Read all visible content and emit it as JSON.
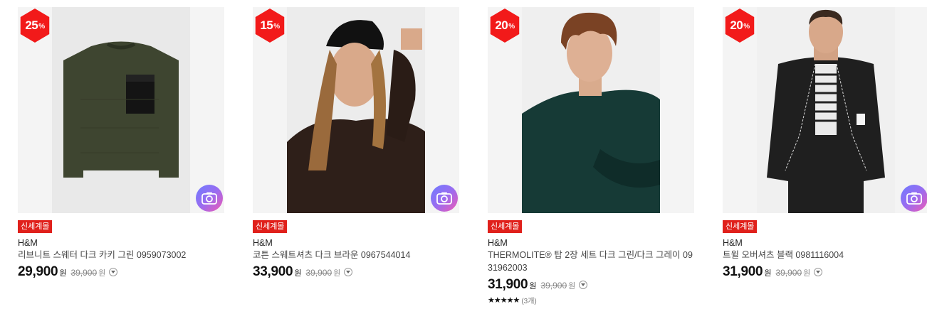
{
  "products": [
    {
      "discount": "25",
      "discount_unit": "%",
      "tag": "신세계몰",
      "brand": "H&M",
      "name": "리브니트 스웨터 다크 카키 그린 0959073002",
      "price": "29,900",
      "price_unit": "원",
      "original_price": "39,900",
      "original_unit": "원"
    },
    {
      "discount": "15",
      "discount_unit": "%",
      "tag": "신세계몰",
      "brand": "H&M",
      "name": "코튼 스웨트셔츠 다크 브라운 0967544014",
      "price": "33,900",
      "price_unit": "원",
      "original_price": "39,900",
      "original_unit": "원"
    },
    {
      "discount": "20",
      "discount_unit": "%",
      "tag": "신세계몰",
      "brand": "H&M",
      "name": "THERMOLITE® 탑 2장 세트 다크 그린/다크 그레이 0931962003",
      "price": "31,900",
      "price_unit": "원",
      "original_price": "39,900",
      "original_unit": "원",
      "stars": "★★★★★",
      "review_count": "(3개)"
    },
    {
      "discount": "20",
      "discount_unit": "%",
      "tag": "신세계몰",
      "brand": "H&M",
      "name": "트윌 오버셔츠 블랙 0981116004",
      "price": "31,900",
      "price_unit": "원",
      "original_price": "39,900",
      "original_unit": "원"
    }
  ],
  "colors": {
    "badge": "#f21a1a",
    "tag": "#e0201b"
  },
  "icons": {
    "image_search": "camera-icon",
    "price_info": "chevron-down-icon",
    "rating": "star-icon"
  }
}
